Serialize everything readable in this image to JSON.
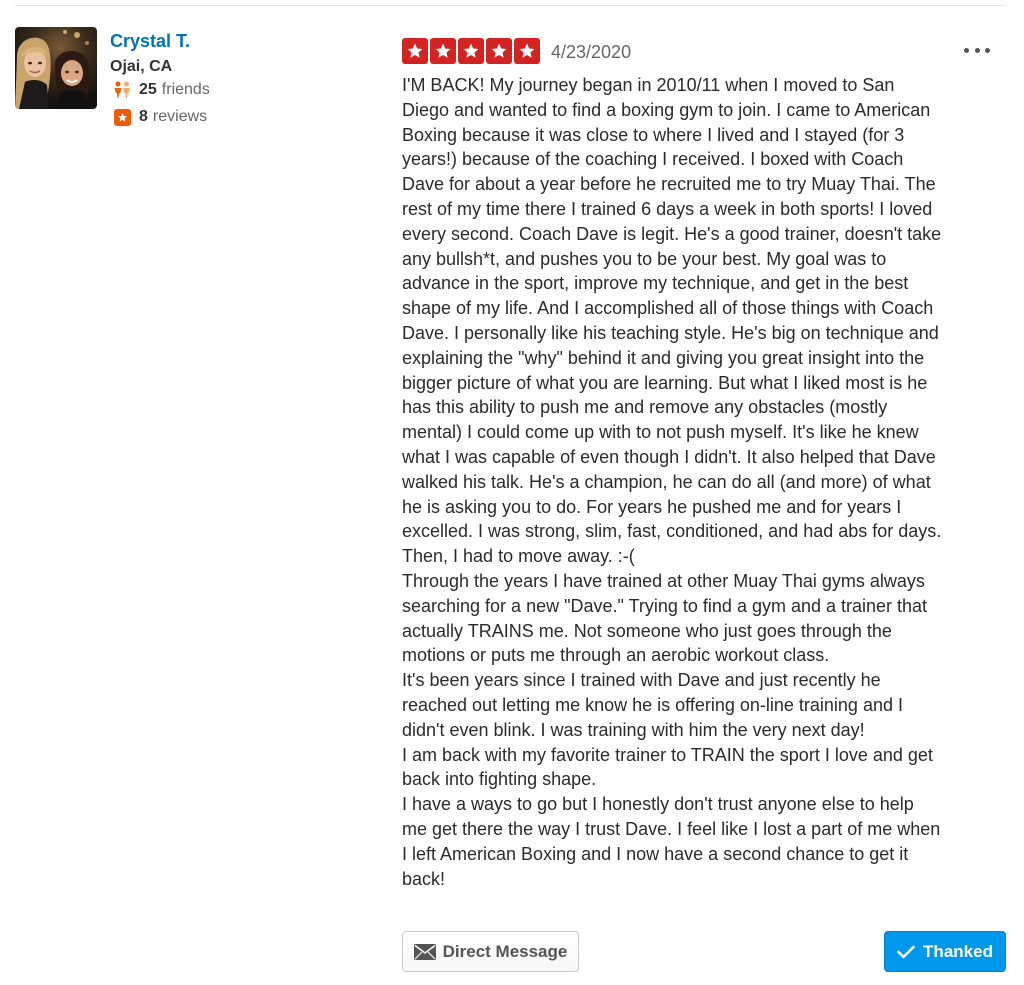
{
  "user": {
    "name": "Crystal T.",
    "location": "Ojai, CA",
    "friends_count": "25",
    "friends_label": "friends",
    "reviews_count": "8",
    "reviews_label": "reviews"
  },
  "review": {
    "rating": 5,
    "rating_max": 5,
    "date": "4/23/2020",
    "lines": [
      "I'M BACK! My journey began in 2010/11 when I moved to San",
      "Diego and wanted to find a boxing gym to join. I came to American",
      "Boxing because it was close to where I lived and I stayed (for 3",
      "years!) because of the coaching I received. I boxed with Coach",
      "Dave for about a year before he recruited me to try Muay Thai. The",
      "rest of my time there I trained 6 days a week in both sports! I loved",
      "every second. Coach Dave is legit. He's a good trainer, doesn't take",
      "any bullsh*t, and pushes you to be your best. My goal was to",
      "advance in the sport, improve my technique, and get in the best",
      "shape of my life. And I accomplished all of those things with Coach",
      "Dave. I personally like his teaching style. He's big on technique and",
      "explaining the \"why\" behind it and giving you great insight into the",
      "bigger picture of what you are learning. But what I liked most is he",
      "has this ability to push me and remove any obstacles (mostly",
      "mental) I could come up with to not push myself. It's like he knew",
      "what I was capable of even though I didn't. It also helped that Dave",
      "walked his talk. He's a champion, he can do all (and more) of what",
      "he is asking you to do. For years he pushed me and for years I",
      "excelled. I was strong, slim, fast, conditioned, and had abs for days.",
      "Then, I had to move away. :-(",
      "Through the years I have trained at other Muay Thai gyms always",
      "searching for a new \"Dave.\" Trying to find a gym and a trainer that",
      "actually TRAINS me. Not someone who just goes through the",
      "motions or puts me through an aerobic workout class.",
      "It's been years since I trained with Dave and just recently he",
      "reached out letting me know he is offering on-line training and I",
      "didn't even blink. I was training with him the very next day!",
      "I am back with my favorite trainer to TRAIN the sport I love and get",
      "back into fighting shape.",
      "I have a ways to go but I honestly don't trust anyone else to help",
      "me get there the way I trust Dave. I feel like I lost a part of me when",
      "I left American Boxing and I now have a second chance to get it",
      "back!"
    ]
  },
  "actions": {
    "direct_message_label": "Direct Message",
    "thanked_label": "Thanked"
  },
  "colors": {
    "star_red": "#d32323",
    "link_blue": "#0073bb",
    "button_blue": "#0097ec",
    "badge_orange": "#f15c00"
  },
  "icons": {
    "friends": "friends-icon",
    "reviews": "review-star-icon",
    "more": "more-options-icon",
    "message": "envelope-icon",
    "thanked": "checkmark-icon"
  }
}
